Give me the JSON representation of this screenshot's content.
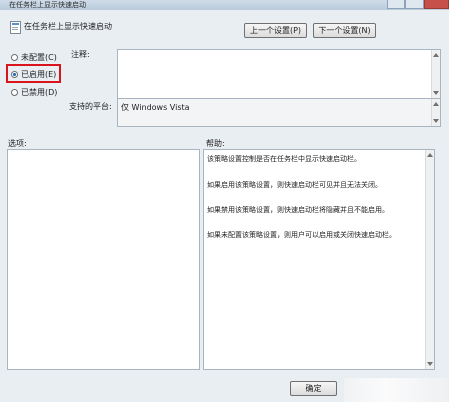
{
  "window": {
    "title": "在任务栏上显示快速启动"
  },
  "policy": {
    "title": "在任务栏上显示快速启动"
  },
  "nav": {
    "prev_label": "上一个设置(P)",
    "next_label": "下一个设置(N)"
  },
  "state": {
    "options": [
      {
        "label": "未配置(C)",
        "selected": false
      },
      {
        "label": "已启用(E)",
        "selected": true
      },
      {
        "label": "已禁用(D)",
        "selected": false
      }
    ]
  },
  "labels": {
    "comment": "注释:",
    "supported": "支持的平台:",
    "options": "选项:",
    "help": "帮助:"
  },
  "supported_value": "仅 Windows Vista",
  "help_text": [
    "该策略设置控制是否在任务栏中显示快速启动栏。",
    "如果启用该策略设置，则快速启动栏可见并且无法关闭。",
    "如果禁用该策略设置，则快速启动栏将隐藏并且不能启用。",
    "如果未配置该策略设置，则用户可以启用或关闭快速启动栏。"
  ],
  "footer": {
    "ok_label": "确定"
  },
  "colors": {
    "highlight": "#d9141b",
    "radio_selected": "#1f5fae"
  }
}
